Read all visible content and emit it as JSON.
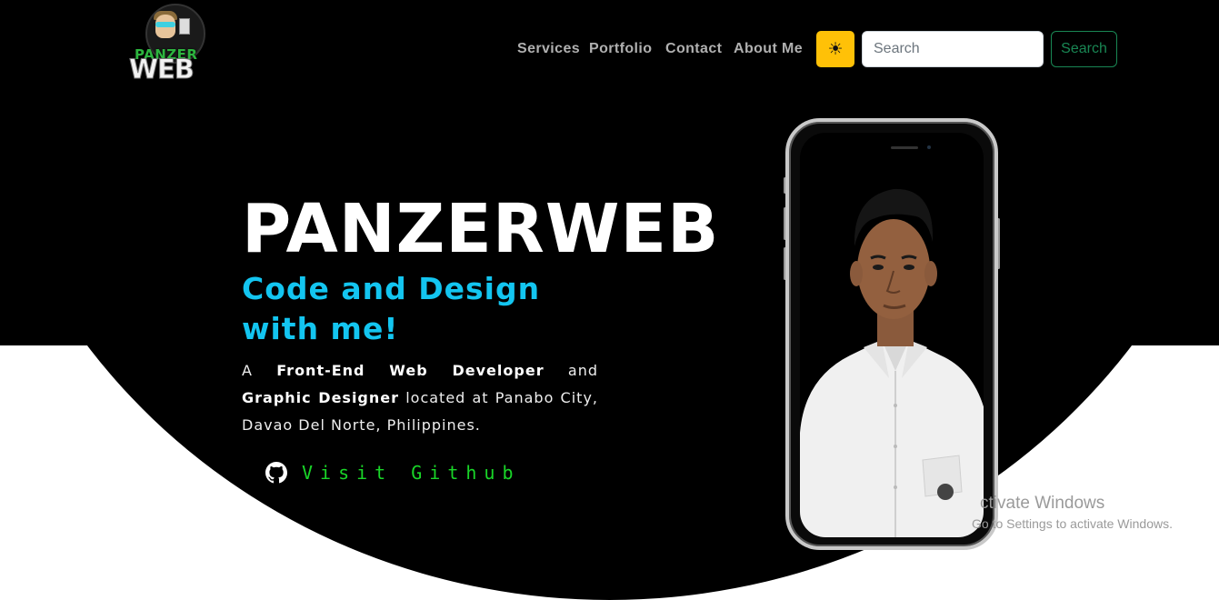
{
  "brand": {
    "line1": "PANZER",
    "line2": "WEB"
  },
  "nav": {
    "links": [
      "Services",
      "Portfolio",
      "Contact",
      "About Me"
    ],
    "theme_icon": "☀",
    "search_placeholder": "Search",
    "search_button": "Search"
  },
  "hero": {
    "title": "PANZERWEB",
    "tagline": "Code and Design with me!",
    "desc_prefix": "A ",
    "desc_role1": "Front-End Web Developer",
    "desc_and": " and ",
    "desc_role2": "Graphic Designer",
    "desc_suffix": " located at Panabo City, Davao Del Norte, Philippines.",
    "github_label": "Visit Github",
    "github_icon": "github-icon"
  },
  "watermark": {
    "line1": "ctivate Windows",
    "line2": "Go to Settings to activate Windows."
  },
  "colors": {
    "background": "#000000",
    "accent_cyan": "#13c5f0",
    "accent_green": "#19d628",
    "theme_button": "#ffc107",
    "search_outline": "#198754"
  }
}
